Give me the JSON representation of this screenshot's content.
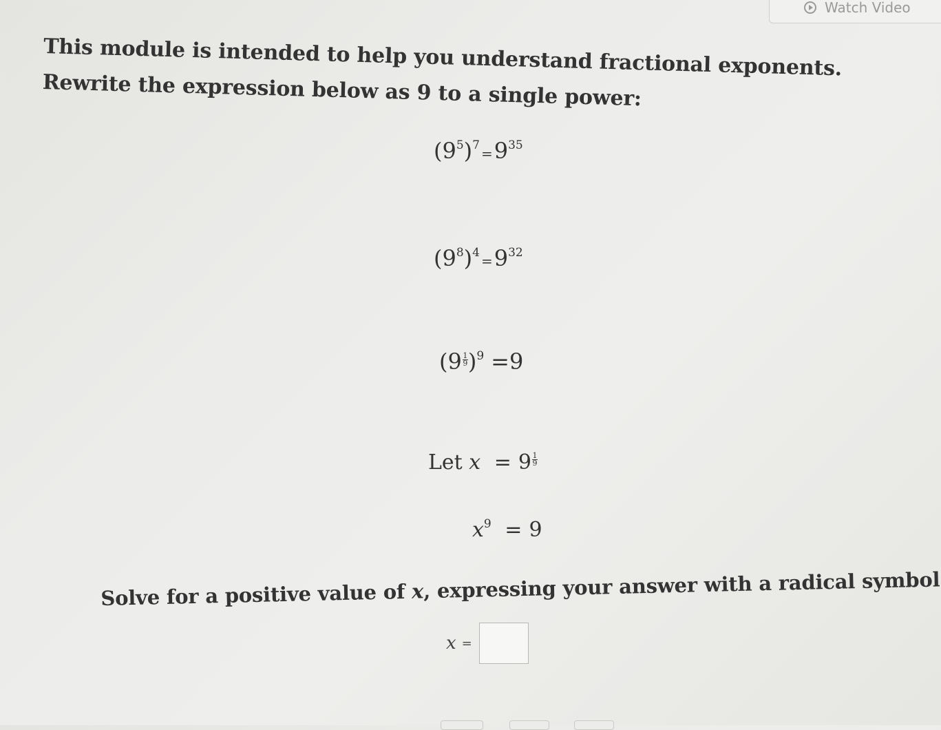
{
  "header": {
    "watch_video_label": "Watch Video"
  },
  "intro": {
    "line1": "This module is intended to help you understand fractional exponents.",
    "line2": "Rewrite the expression below as 9 to a single power:"
  },
  "equations": [
    {
      "base": "9",
      "inner_exp": "5",
      "outer_exp": "7",
      "eq": "=",
      "result_base": "9",
      "result_exp": "35"
    },
    {
      "base": "9",
      "inner_exp": "8",
      "outer_exp": "4",
      "eq": "=",
      "result_base": "9",
      "result_exp": "32"
    },
    {
      "base": "9",
      "frac_num": "1",
      "frac_den": "9",
      "outer_exp": "9",
      "eq": "=",
      "result": "9"
    }
  ],
  "let_statement": {
    "prefix": "Let",
    "var": "x",
    "eq": "=",
    "base": "9",
    "frac_num": "1",
    "frac_den": "9"
  },
  "power_statement": {
    "var": "x",
    "exp": "9",
    "eq": "=",
    "result": "9"
  },
  "prompt": {
    "text_before": "Solve for a positive value of ",
    "var": "x",
    "text_after": ", expressing your answer with a radical symbol."
  },
  "answer": {
    "var": "x",
    "eq": "=",
    "value": "",
    "placeholder": ""
  }
}
